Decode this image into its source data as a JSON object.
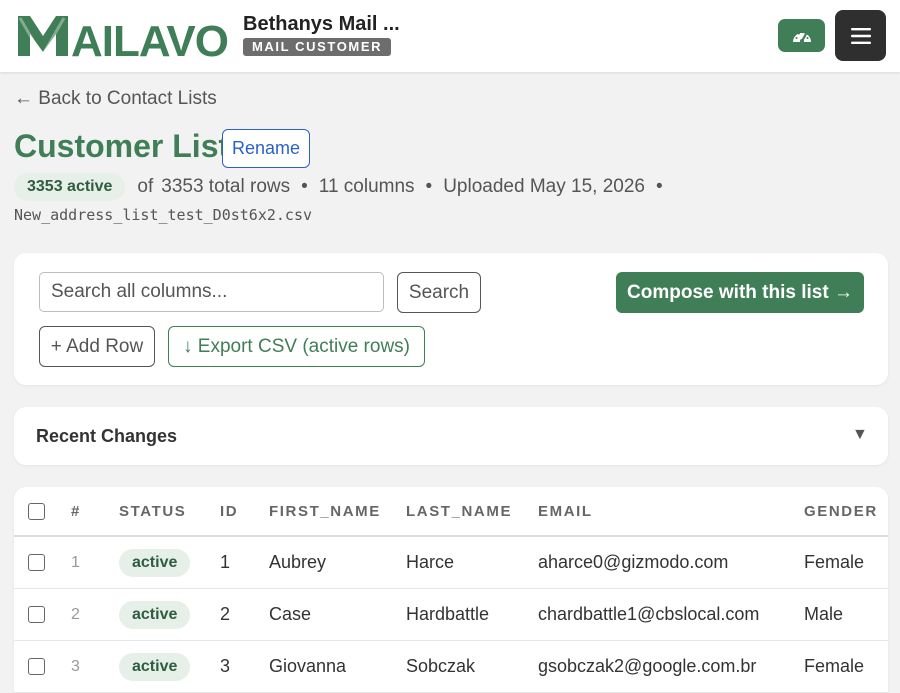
{
  "header": {
    "logo_text": "MAILAVO",
    "account_name": "Bethanys Mail ...",
    "account_role": "MAIL CUSTOMER",
    "dashboard_icon": "gauge-icon",
    "menu_icon": "hamburger-menu-icon"
  },
  "nav": {
    "back_link": "← Back to Contact Lists"
  },
  "list": {
    "title": "Customer List",
    "rename_label": "Rename",
    "active_count": "3353 active",
    "of_text": "of",
    "total_rows": "3353 total rows",
    "columns": "11 columns",
    "uploaded": "Uploaded May 15, 2026",
    "separator": "•",
    "filename": "New_address_list_test_D0st6x2.csv"
  },
  "tools": {
    "search_placeholder": "Search all columns...",
    "search_label": "Search",
    "compose_label": "Compose with this list →",
    "add_row_label": "+ Add Row",
    "export_label": "↓ Export CSV (active rows)"
  },
  "changes": {
    "title": "Recent Changes",
    "toggle": "▼"
  },
  "table": {
    "headers": {
      "num": "#",
      "status": "STATUS",
      "id": "ID",
      "first_name": "FIRST_NAME",
      "last_name": "LAST_NAME",
      "email": "EMAIL",
      "gender": "GENDER"
    },
    "rows": [
      {
        "num": "1",
        "status": "active",
        "id": "1",
        "first_name": "Aubrey",
        "last_name": "Harce",
        "email": "aharce0@gizmodo.com",
        "gender": "Female"
      },
      {
        "num": "2",
        "status": "active",
        "id": "2",
        "first_name": "Case",
        "last_name": "Hardbattle",
        "email": "chardbattle1@cbslocal.com",
        "gender": "Male"
      },
      {
        "num": "3",
        "status": "active",
        "id": "3",
        "first_name": "Giovanna",
        "last_name": "Sobczak",
        "email": "gsobczak2@google.com.br",
        "gender": "Female"
      }
    ]
  },
  "colors": {
    "brand_green": "#3f7e57",
    "link_blue": "#2b62c8",
    "dark_button": "#2f2f2f",
    "pill_bg": "#e6efe8"
  }
}
